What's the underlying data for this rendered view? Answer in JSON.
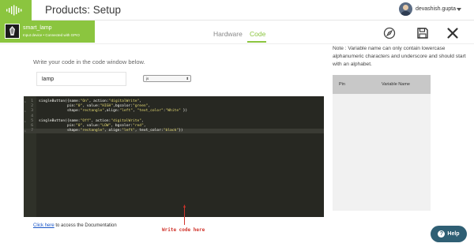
{
  "header": {
    "title": "Products: Setup",
    "username": "devashish.gupta"
  },
  "device": {
    "name": "smart_lamp",
    "status": "Input device • Connected with GPIO"
  },
  "tabs": [
    {
      "label": "Hardware",
      "active": false
    },
    {
      "label": "Code",
      "active": true
    }
  ],
  "icons": [
    "logo-icon",
    "compass-icon",
    "save-icon",
    "close-icon"
  ],
  "main": {
    "instruction": "Write your code in the code window below.",
    "name_value": "lamp",
    "language_selected": "js",
    "annotation": "Write code here",
    "doc_link": "Click here",
    "doc_suffix": " to access the Documentation"
  },
  "code_lines": [
    {
      "n": "1",
      "fold": true,
      "text": "singleButton({name:\"On\", action:\"digitalWrite\","
    },
    {
      "n": "2",
      "fold": false,
      "text": "             pin:\"0\", value:\"HIGH\",bgcolor:\"green\","
    },
    {
      "n": "3",
      "fold": true,
      "text": "             shape:\"rectangle\",align:\"left\", \"text_color\":\"White\" })"
    },
    {
      "n": "4",
      "fold": false,
      "text": ""
    },
    {
      "n": "5",
      "fold": true,
      "text": "singleButton({name:\"Off\", action:\"digitalWrite\","
    },
    {
      "n": "6",
      "fold": false,
      "text": "             pin:\"0\", value:\"LOW\", bgcolor:\"red\","
    },
    {
      "n": "7",
      "fold": true,
      "text": "             shape:\"rectangle\", align:\"left\", text_color:\"black\"})"
    }
  ],
  "right_panel": {
    "note": "Note : Variable name can only contain lowercase alphanumeric characters and underscore and should start with an alphabet.",
    "columns": [
      "Pin",
      "Variable Name"
    ]
  },
  "help": {
    "label": "Help"
  },
  "colors": {
    "accent": "#8bc53f",
    "editor_bg": "#272822",
    "help_bg": "#2f5f74",
    "annotation": "#d0332b"
  }
}
